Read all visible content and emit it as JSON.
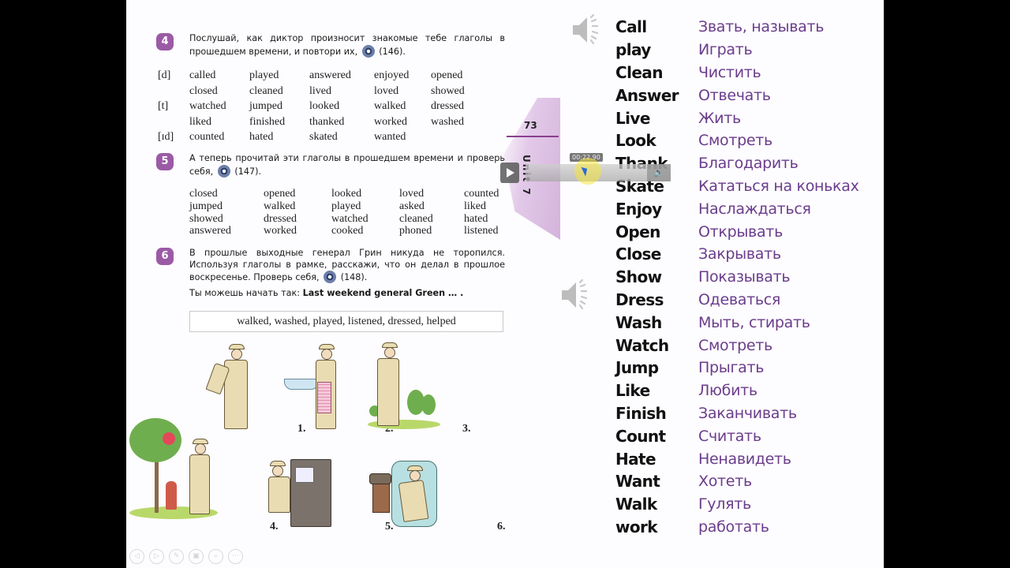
{
  "book": {
    "page_number": "73",
    "unit_label": "Unit 7",
    "exercises": [
      {
        "number": "4",
        "text_before": "Послушай, как диктор произносит знакомые тебе глаголы в прошедшем времени, и повтори их,",
        "track": "(146).",
        "groups": [
          {
            "sound": "[d]",
            "rows": [
              [
                "called",
                "played",
                "answered",
                "enjoyed",
                "opened"
              ],
              [
                "closed",
                "cleaned",
                "lived",
                "loved",
                "showed"
              ]
            ]
          },
          {
            "sound": "[t]",
            "rows": [
              [
                "watched",
                "jumped",
                "looked",
                "walked",
                "dressed"
              ],
              [
                "liked",
                "finished",
                "thanked",
                "worked",
                "washed"
              ]
            ]
          },
          {
            "sound": "[ɪd]",
            "rows": [
              [
                "counted",
                "hated",
                "skated",
                "wanted",
                ""
              ]
            ]
          }
        ]
      },
      {
        "number": "5",
        "text_before": "А теперь прочитай эти глаголы в прошедшем времени и проверь себя,",
        "track": "(147).",
        "rows": [
          [
            "closed",
            "opened",
            "looked",
            "loved",
            "counted"
          ],
          [
            "jumped",
            "walked",
            "played",
            "asked",
            "liked"
          ],
          [
            "showed",
            "dressed",
            "watched",
            "cleaned",
            "hated"
          ],
          [
            "answered",
            "worked",
            "cooked",
            "phoned",
            "listened"
          ]
        ]
      },
      {
        "number": "6",
        "text_before": "В прошлые выходные генерал Грин никуда не торопился. Используя глаголы в рамке, расскажи, что он делал в прошлое воскресенье. Проверь себя,",
        "track": "(148).",
        "start_prompt": "Ты можешь начать так:",
        "start_phrase": "Last weekend general Green … .",
        "word_box": "walked, washed, played, listened, dressed, helped",
        "picture_labels": [
          "1.",
          "2.",
          "3.",
          "4.",
          "5.",
          "6."
        ]
      }
    ]
  },
  "vocabulary": [
    {
      "en": "Call",
      "ru": "Звать, называть"
    },
    {
      "en": "play",
      "ru": "Играть"
    },
    {
      "en": "Clean",
      "ru": "Чистить"
    },
    {
      "en": "Answer",
      "ru": "Отвечать"
    },
    {
      "en": "Live",
      "ru": "Жить"
    },
    {
      "en": "Look",
      "ru": "Смотреть"
    },
    {
      "en": "Thank",
      "ru": "Благодарить"
    },
    {
      "en": "Skate",
      "ru": "Кататься на коньках"
    },
    {
      "en": "Enjoy",
      "ru": "Наслаждаться"
    },
    {
      "en": "Open",
      "ru": "Открывать"
    },
    {
      "en": "Close",
      "ru": "Закрывать"
    },
    {
      "en": "Show",
      "ru": "Показывать"
    },
    {
      "en": "Dress",
      "ru": "Одеваться"
    },
    {
      "en": "Wash",
      "ru": "Мыть, стирать"
    },
    {
      "en": "Watch",
      "ru": "Смотреть"
    },
    {
      "en": "Jump",
      "ru": "Прыгать"
    },
    {
      "en": "Like",
      "ru": "Любить"
    },
    {
      "en": "Finish",
      "ru": "Заканчивать"
    },
    {
      "en": "Count",
      "ru": "Считать"
    },
    {
      "en": "Hate",
      "ru": "Ненавидеть"
    },
    {
      "en": "Want",
      "ru": "Хотеть"
    },
    {
      "en": "Walk",
      "ru": "Гулять"
    },
    {
      "en": "work",
      "ru": "работать"
    }
  ],
  "player": {
    "time": "00:22.90",
    "play_icon": "play-icon",
    "volume_icon": "volume-icon"
  },
  "nav_toolbar": [
    {
      "name": "previous-slide",
      "glyph": "◁"
    },
    {
      "name": "next-slide",
      "glyph": "▷"
    },
    {
      "name": "pen",
      "glyph": "✎"
    },
    {
      "name": "slides",
      "glyph": "▣"
    },
    {
      "name": "zoom",
      "glyph": "⌕"
    },
    {
      "name": "more",
      "glyph": "⋯"
    }
  ],
  "colors": {
    "accent_purple": "#9b5aa6",
    "translation": "#6a3d8c"
  }
}
